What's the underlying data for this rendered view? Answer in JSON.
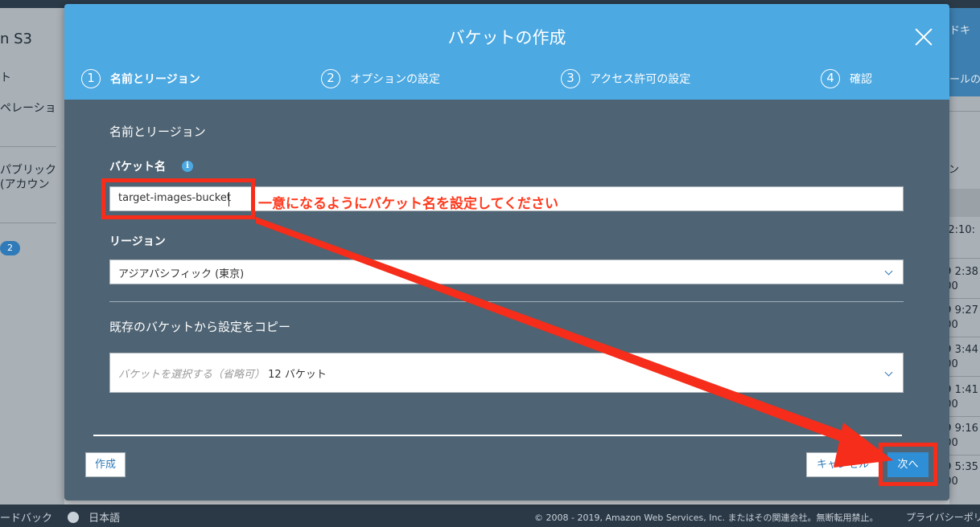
{
  "background": {
    "left_title": "n S3",
    "left_nav": [
      "ト",
      "ペレーショ",
      "パブリック",
      "(アカウン"
    ],
    "left_badge": "2",
    "right_top_items": [
      "ドキ",
      "ールの"
    ],
    "right_header": "ョン",
    "right_cells": [
      "9 2:10:",
      "19 2:38",
      "900",
      "19 9:27",
      "900",
      "19 3:44",
      "900",
      "19 1:41",
      "900",
      "19 9:16",
      "900",
      "19 5:35",
      "900"
    ]
  },
  "footer": {
    "feedback": "ードバック",
    "language": "日本語",
    "copyright": "© 2008 - 2019, Amazon Web Services, Inc. またはその関連会社。無断転用禁止。",
    "privacy": "プライバシーポリ"
  },
  "modal": {
    "title": "バケットの作成",
    "steps": [
      {
        "num": "1",
        "label": "名前とリージョン"
      },
      {
        "num": "2",
        "label": "オプションの設定"
      },
      {
        "num": "3",
        "label": "アクセス許可の設定"
      },
      {
        "num": "4",
        "label": "確認"
      }
    ],
    "section_title": "名前とリージョン",
    "bucket_name_label": "バケット名",
    "bucket_name_value": "target-images-bucket",
    "region_label": "リージョン",
    "region_value": "アジアパシフィック (東京)",
    "copy_label": "既存のバケットから設定をコピー",
    "copy_placeholder": "バケットを選択する（省略可）",
    "copy_count": "12 バケット",
    "create_button": "作成",
    "cancel_button": "キャンセル",
    "next_button": "次へ"
  },
  "annotation": {
    "text": "一意になるようにバケット名を設定してください",
    "color": "#f52d1a"
  }
}
